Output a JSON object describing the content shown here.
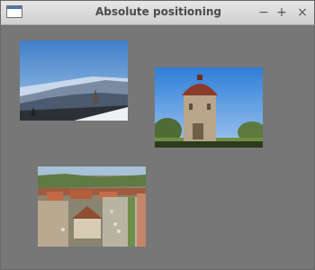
{
  "window": {
    "title": "Absolute positioning",
    "controls": {
      "minimize": "−",
      "maximize": "+",
      "close": "×"
    }
  },
  "colors": {
    "background": "#777777",
    "titlebar": "#d6d6d6",
    "title_text": "#4a4a4a"
  },
  "icons": [
    "window-icon",
    "minimize-icon",
    "maximize-icon",
    "close-icon"
  ]
}
